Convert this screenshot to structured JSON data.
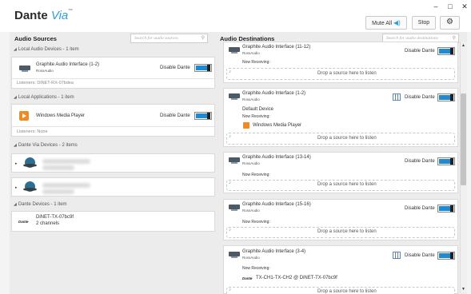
{
  "app": {
    "name": "Dante",
    "name_via": "Via",
    "trademark": "™"
  },
  "window": {
    "minimize": "–",
    "maximize": "□",
    "close": "✕"
  },
  "toolbar": {
    "mute_all": "Mute All",
    "stop": "Stop",
    "speaker_icon": "speaker-icon",
    "settings_icon": "gear-icon"
  },
  "sources": {
    "title": "Audio Sources",
    "search_placeholder": "Search for audio sources",
    "local_audio": {
      "header": "Local Audio Devices - 1 item",
      "device": {
        "name": "Graphite Audio Interface (1-2)",
        "vendor": "RossAudio",
        "toggle_label": "Disable Dante"
      },
      "listeners": "Listeners: DiNET-RX-07bdea"
    },
    "local_apps": {
      "header": "Local Applications - 1 item",
      "app": {
        "name": "Windows Media Player",
        "toggle_label": "Disable Dante"
      },
      "listeners": "Listeners: None"
    },
    "via_devices": {
      "header": "Dante Via Devices - 2 items"
    },
    "dante_devices": {
      "header": "Dante Devices - 1 item",
      "device": {
        "logo": "Dante",
        "name": "DiNET-TX-07bc9f",
        "channels": "2 channels"
      }
    }
  },
  "destinations": {
    "title": "Audio Destinations",
    "search_placeholder": "Search for audio destinations",
    "now_receiving": "Now Receiving:",
    "drop_text": "Drop a source here to listen",
    "toggle_label": "Disable Dante",
    "items": [
      {
        "name": "Graphite Audio Interface (11-12)",
        "vendor": "RossAudio"
      },
      {
        "name": "Graphite Audio Interface (1-2)",
        "vendor": "RossAudio",
        "default": "Default Device",
        "receiving": "Windows Media Player"
      },
      {
        "name": "Graphite Audio Interface (13-14)",
        "vendor": "RossAudio"
      },
      {
        "name": "Graphite Audio Interface (15-16)",
        "vendor": "RossAudio"
      },
      {
        "name": "Graphite Audio Interface (3-4)",
        "vendor": "RossAudio",
        "receiving_logo": "Dante",
        "receiving": "TX-CH1-TX-CH2 @ DiNET-TX-07bc9f"
      }
    ]
  }
}
